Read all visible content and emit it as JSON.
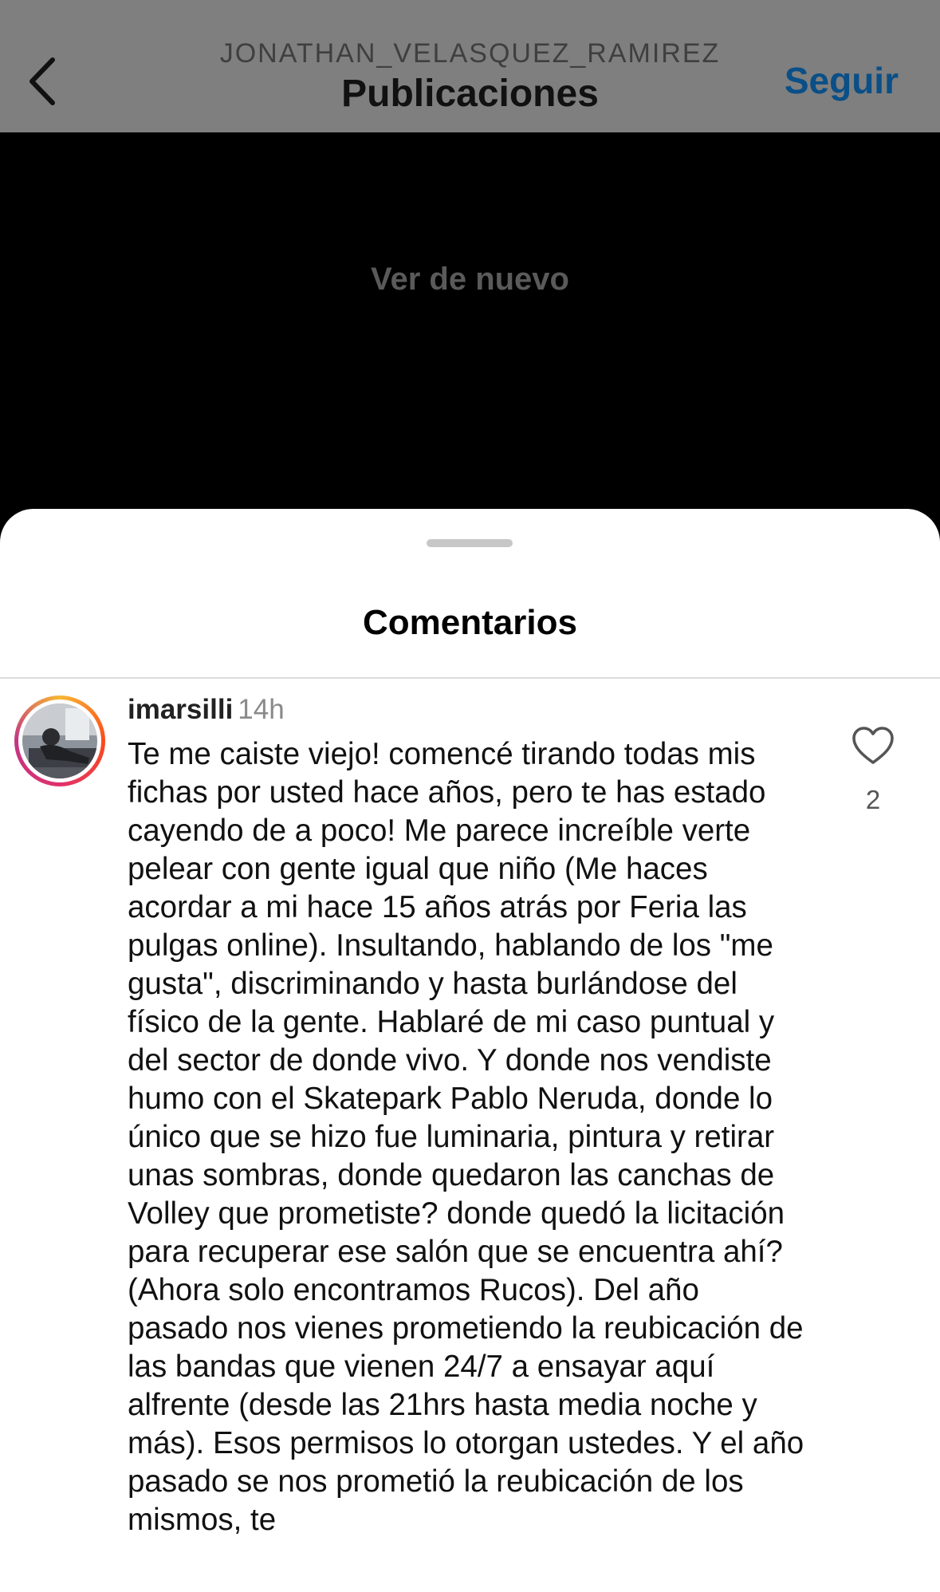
{
  "header": {
    "username": "JONATHAN_VELASQUEZ_RAMIREZ",
    "title": "Publicaciones",
    "follow_label": "Seguir",
    "back_icon": "chevron-left-icon"
  },
  "media": {
    "replay_label": "Ver de nuevo"
  },
  "comments_sheet": {
    "title": "Comentarios",
    "comment": {
      "username": "imarsilli",
      "time": "14h",
      "text": "Te me caiste viejo! comencé tirando todas mis fichas por usted hace años, pero te has estado cayendo de a poco! Me parece increíble verte pelear con gente igual que niño (Me haces acordar a mi hace 15 años atrás por Feria las pulgas online). Insultando, hablando de los \"me gusta\", discriminando y hasta burlándose del físico de la gente. Hablaré de mi caso puntual y del sector de donde vivo. Y donde nos vendiste humo con el Skatepark Pablo Neruda, donde lo único que se hizo fue luminaria, pintura y retirar unas sombras, donde quedaron las canchas de Volley que prometiste? donde quedó la licitación para recuperar ese salón que se encuentra ahí? (Ahora solo encontramos Rucos). Del año pasado nos vienes prometiendo la reubicación de las bandas que vienen 24/7 a ensayar aquí alfrente (desde las 21hrs hasta media noche y más). Esos permisos lo otorgan ustedes. Y el año pasado se nos prometió la reubicación de los mismos, te",
      "like_count": "2",
      "like_icon": "heart-outline-icon"
    }
  },
  "colors": {
    "follow": "#0a4f87",
    "overlay_bar": "#7f7f7f"
  }
}
